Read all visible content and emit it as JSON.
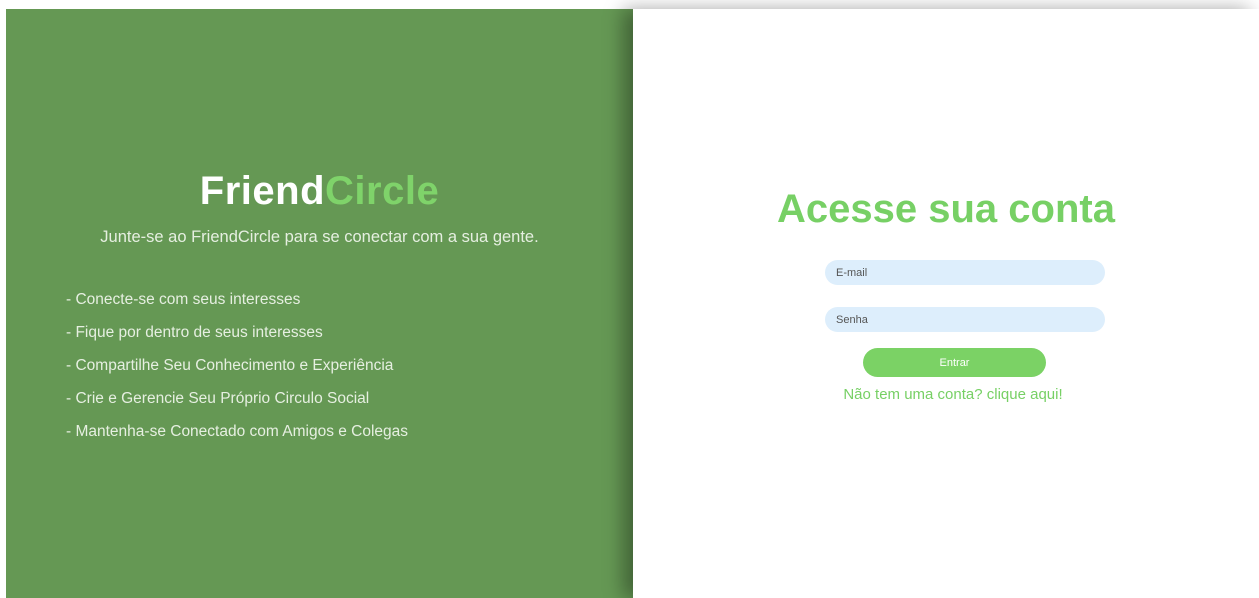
{
  "brand": {
    "name_part1": "Friend",
    "name_part2": "Circle",
    "tagline": "Junte-se ao FriendCircle para se conectar com a sua gente."
  },
  "features": [
    "- Conecte-se com seus interesses",
    "- Fique por dentro de seus interesses",
    "- Compartilhe Seu Conhecimento e Experiência",
    "- Crie e Gerencie Seu Próprio Circulo Social",
    "- Mantenha-se Conectado com Amigos e Colegas"
  ],
  "login": {
    "title": "Acesse sua conta",
    "email_placeholder": "E-mail",
    "password_placeholder": "Senha",
    "submit_label": "Entrar",
    "signup_text": "Não tem uma conta? clique aqui!"
  },
  "colors": {
    "panel_green": "#659854",
    "accent_green": "#77d065",
    "input_bg": "#ddeefc"
  }
}
